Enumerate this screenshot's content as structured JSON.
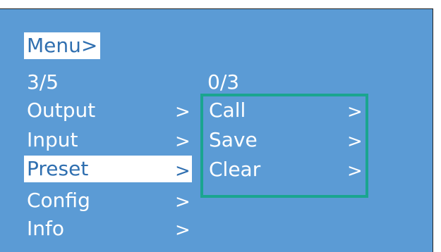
{
  "menu": {
    "title": "Menu>",
    "position": "3/5",
    "items": [
      {
        "label": "Output",
        "arrow": ">"
      },
      {
        "label": "Input",
        "arrow": ">"
      },
      {
        "label": "Preset",
        "arrow": ">",
        "selected": true
      },
      {
        "label": "Config",
        "arrow": ">"
      },
      {
        "label": "Info",
        "arrow": ">"
      }
    ]
  },
  "submenu": {
    "position": "0/3",
    "items": [
      {
        "label": "Call",
        "arrow": ">"
      },
      {
        "label": "Save",
        "arrow": ">"
      },
      {
        "label": "Clear",
        "arrow": ">"
      }
    ]
  },
  "colors": {
    "screen_background": "#5b9bd5",
    "text": "#ffffff",
    "highlight_background": "#ffffff",
    "highlight_text": "#2f6fb0",
    "submenu_border": "#1aa58f"
  }
}
